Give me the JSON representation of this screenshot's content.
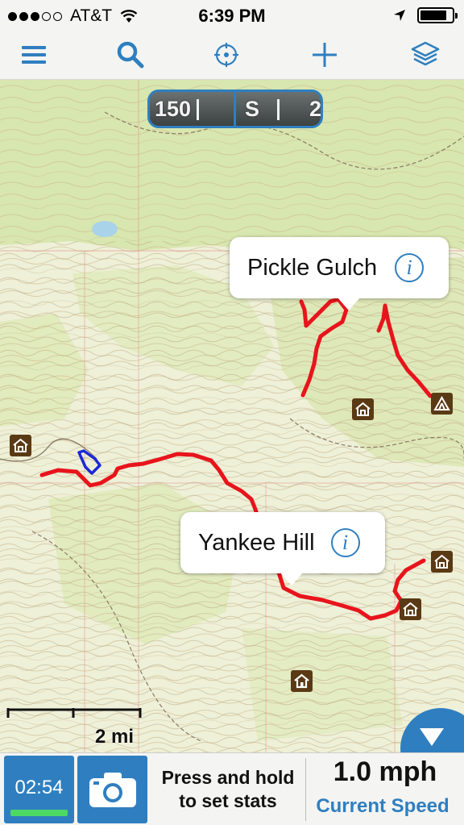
{
  "status_bar": {
    "carrier": "AT&T",
    "time": "6:39 PM",
    "signal_bars": 3,
    "battery_level": 0.85
  },
  "toolbar": {
    "buttons": [
      {
        "icon": "menu-icon"
      },
      {
        "icon": "search-icon"
      },
      {
        "icon": "crosshair-icon"
      },
      {
        "icon": "plus-icon"
      },
      {
        "icon": "layers-icon"
      }
    ],
    "accent_color": "#2f7fc0"
  },
  "compass": {
    "left_value": "150",
    "heading": "S",
    "right_value": "2"
  },
  "map": {
    "callouts": [
      {
        "name": "Pickle Gulch",
        "info_glyph": "i"
      },
      {
        "name": "Yankee Hill",
        "info_glyph": "i"
      }
    ],
    "poi_icons": [
      "cabin-icon",
      "cabin-icon",
      "campground-icon",
      "cabin-icon",
      "cabin-icon",
      "home-icon"
    ],
    "track_color": "#e8141c",
    "recorded_track_color": "#1a28d8",
    "scale_label": "2 mi"
  },
  "bottom_bar": {
    "timer": "02:54",
    "stats_hint": "Press and hold to set stats",
    "speed_value": "1.0 mph",
    "speed_label": "Current Speed"
  }
}
